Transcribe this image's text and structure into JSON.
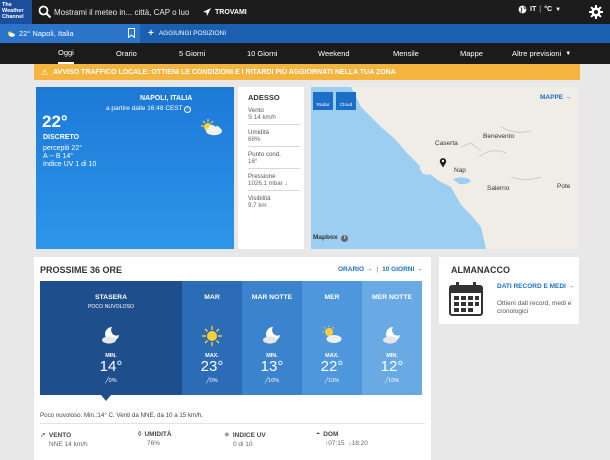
{
  "header": {
    "logo_lines": [
      "The",
      "Weather",
      "Channel"
    ],
    "search_placeholder": "Mostrami il meteo in... città, CAP o luogo",
    "find_label": "TROVAMI",
    "lang": "IT",
    "unit": "°C"
  },
  "locations": {
    "current": "22° Napoli, Italia",
    "add_label": "AGGIUNGI POSIZIONI"
  },
  "tabs": [
    "Oggi",
    "Orario",
    "5 Giorni",
    "10 Giorni",
    "Weekend",
    "Mensile",
    "Mappe",
    "Altre previsioni"
  ],
  "alert": {
    "text": "AVVISO TRAFFICO LOCALE: OTTIENI LE CONDIZIONI E I RITARDI PIÙ AGGIORNATI NELLA TUA ZONA"
  },
  "current": {
    "city": "NAPOLI, ITALIA",
    "updated": "a partire dalle 16:48 CEST",
    "temp": "22°",
    "phrase": "DISCRETO",
    "feels": "percepiti 22°",
    "hilo": "A -- B 14°",
    "uv": "Indice UV 1 di 10",
    "icon": "partly-cloudy-icon"
  },
  "details": {
    "title": "ADESSO",
    "items": [
      {
        "label": "Vento",
        "value": "S 14 km/h"
      },
      {
        "label": "Umidità",
        "value": "68%"
      },
      {
        "label": "Punto cond.",
        "value": "16°"
      },
      {
        "label": "Pressione",
        "value": "1026.1 mbar ↓"
      },
      {
        "label": "Visibilità",
        "value": "9.7 km"
      }
    ]
  },
  "map": {
    "radar": "Radar",
    "cloud": "Cloud",
    "link": "MAPPE",
    "cities": [
      "Caserta",
      "Benevento",
      "Nap",
      "Salerno",
      "Pote"
    ],
    "attribution": "Mapbox"
  },
  "forecast": {
    "title": "PROSSIME 36 ORE",
    "link_hourly": "ORARIO",
    "link_10day": "10 GIORNI",
    "periods": [
      {
        "when": "STASERA",
        "phrase": "POCO NUVOLOSO",
        "label": "MIN.",
        "temp": "14°",
        "precip": "0%",
        "icon": "moon-cloud-icon",
        "color": "#1f4e8c"
      },
      {
        "when": "MAR",
        "phrase": "",
        "label": "MAX.",
        "temp": "23°",
        "precip": "0%",
        "icon": "sun-icon",
        "color": "#2c6bb5"
      },
      {
        "when": "MAR NOTTE",
        "phrase": "",
        "label": "MIN.",
        "temp": "13°",
        "precip": "10%",
        "icon": "moon-cloud-icon",
        "color": "#3b83cd"
      },
      {
        "when": "MER",
        "phrase": "",
        "label": "MAX.",
        "temp": "22°",
        "precip": "10%",
        "icon": "sun-cloud-icon",
        "color": "#4e97dc"
      },
      {
        "when": "MER NOTTE",
        "phrase": "",
        "label": "MIN.",
        "temp": "12°",
        "precip": "10%",
        "icon": "moon-cloud-icon",
        "color": "#6aaae4"
      }
    ],
    "narrative": "Poco nuvoloso. Min.:14° C. Venti da NNE, da 10 a 15 km/h.",
    "stats": [
      {
        "label": "VENTO",
        "value": "NNE 14 km/h",
        "icon": "wind-icon"
      },
      {
        "label": "UMIDITÀ",
        "value": "76%",
        "icon": "drop-icon"
      },
      {
        "label": "INDICE UV",
        "value": "0 di 10",
        "icon": "uv-icon"
      },
      {
        "label": "DOM",
        "sunrise": "07:15",
        "sunset": "18:20",
        "icon": "sunrise-icon"
      }
    ]
  },
  "almanac": {
    "title": "ALMANACCO",
    "link": "DATI RECORD E MEDI",
    "desc": "Ottieni dati record, medi e cronologici"
  }
}
